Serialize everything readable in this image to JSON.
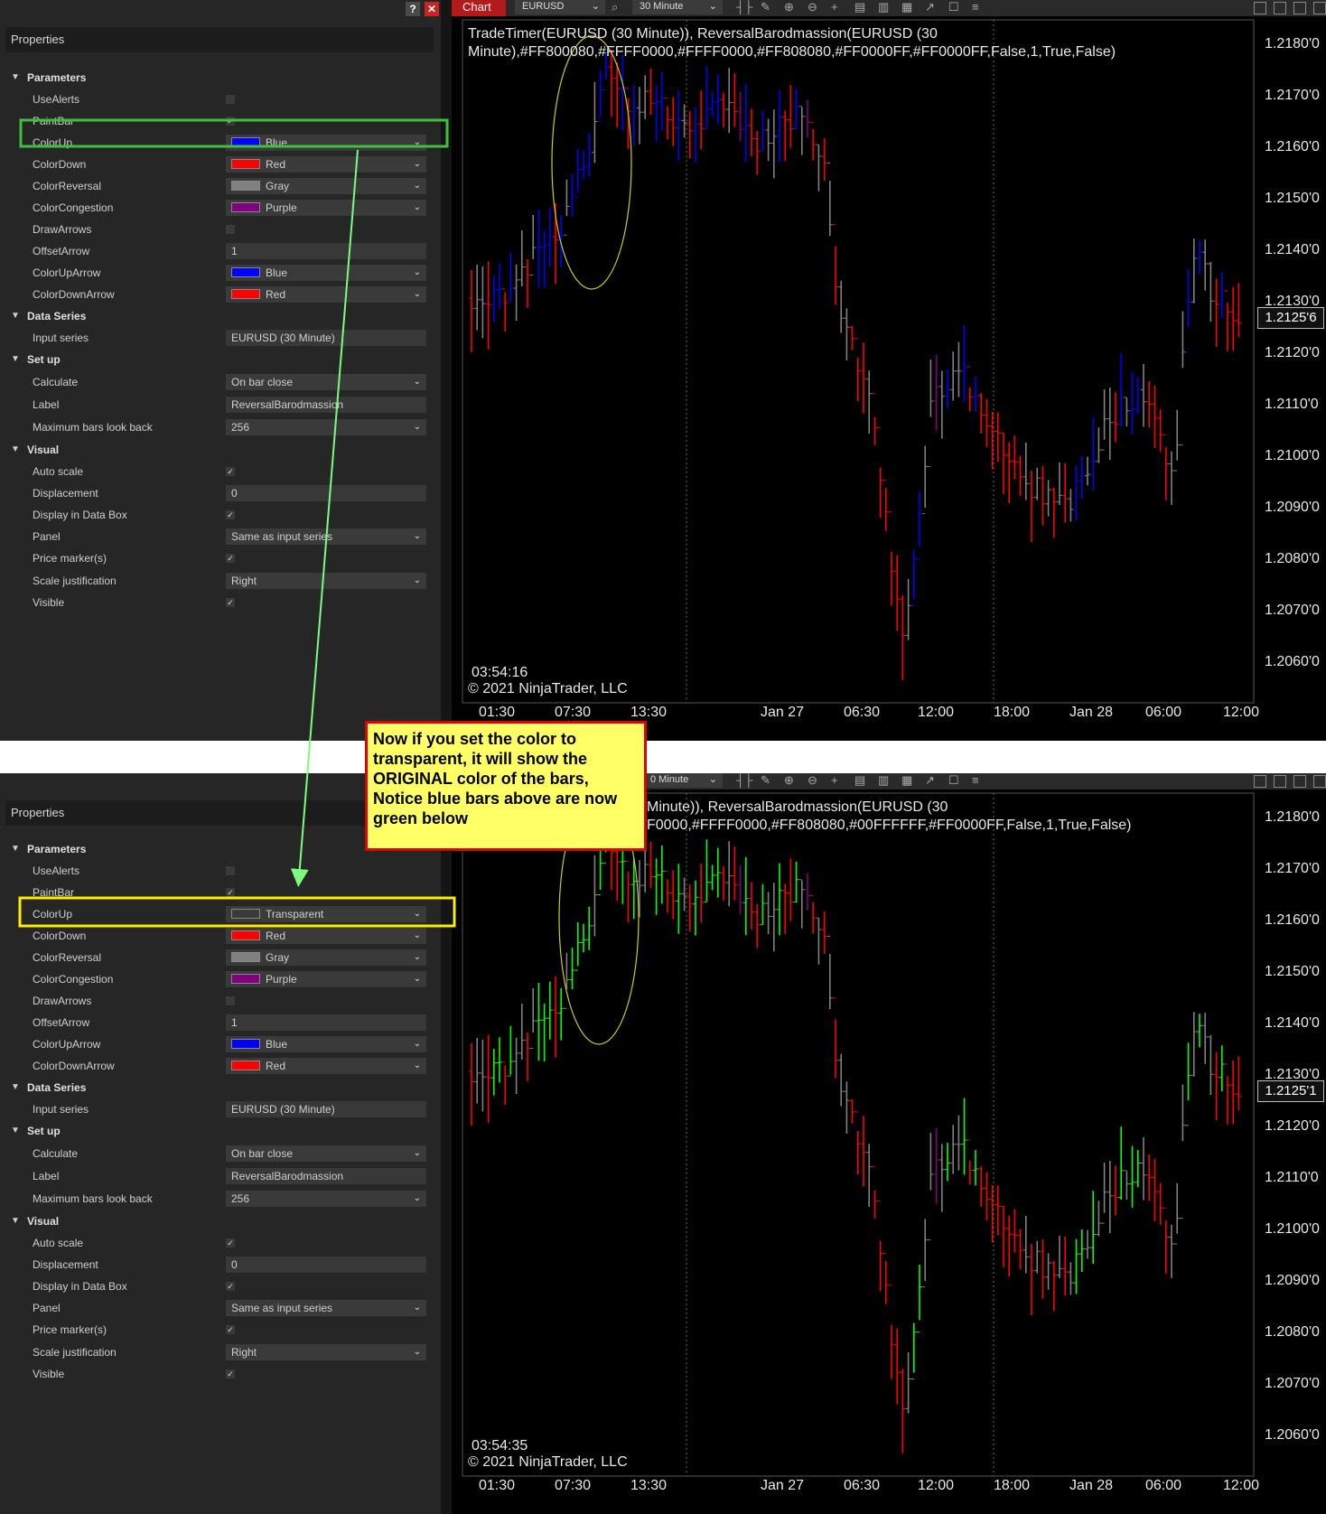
{
  "properties": {
    "title": "Properties",
    "sections": {
      "parameters": "Parameters",
      "data_series": "Data Series",
      "setup": "Set up",
      "visual": "Visual"
    },
    "labels": {
      "use_alerts": "UseAlerts",
      "paint_bar": "PaintBar",
      "color_up": "ColorUp",
      "color_down": "ColorDown",
      "color_reversal": "ColorReversal",
      "color_congestion": "ColorCongestion",
      "draw_arrows": "DrawArrows",
      "offset_arrow": "OffsetArrow",
      "color_up_arrow": "ColorUpArrow",
      "color_down_arrow": "ColorDownArrow",
      "input_series": "Input series",
      "calculate": "Calculate",
      "label": "Label",
      "max_bars": "Maximum bars look back",
      "auto_scale": "Auto scale",
      "displacement": "Displacement",
      "display_in_data_box": "Display in Data Box",
      "panel": "Panel",
      "price_markers": "Price marker(s)",
      "scale_justification": "Scale justification",
      "visible": "Visible"
    },
    "values": {
      "color_down": "Red",
      "color_reversal": "Gray",
      "color_congestion": "Purple",
      "offset_arrow": "1",
      "color_up_arrow": "Blue",
      "color_down_arrow": "Red",
      "input_series": "EURUSD (30 Minute)",
      "calculate": "On bar close",
      "label": "ReversalBarodmassion",
      "max_bars": "256",
      "displacement": "0",
      "panel": "Same as input series",
      "scale_justification": "Right"
    },
    "top_color_up": "Blue",
    "bottom_color_up": "Transparent"
  },
  "colors": {
    "blue": "#0000ff",
    "red": "#ff0000",
    "gray": "#808080",
    "purple": "#800080",
    "green": "#00ff00",
    "highlight_green": "#3fbf3f",
    "highlight_yellow": "#ffee00",
    "callout_bg": "#ffff66",
    "callout_border": "#e00000"
  },
  "chart": {
    "tab": "Chart",
    "instrument": "EURUSD",
    "interval": "30 Minute",
    "interval_partial": "0 Minute",
    "indicator_label_top": "TradeTimer(EURUSD (30 Minute)), ReversalBarodmassion(EURUSD (30 Minute),#FF800080,#FFFF0000,#FFFF0000,#FF808080,#FF0000FF,#FF0000FF,False,1,True,False)",
    "indicator_label_bottom": "Minute)), ReversalBarodmassion(EURUSD (30 F0000,#FFFF0000,#FF808080,#00FFFFFF,#FF0000FF,False,1,True,False)",
    "clock_top": "03:54:16",
    "clock_bottom": "03:54:35",
    "copyright": "© 2021 NinjaTrader, LLC",
    "price_labels": [
      "1.2180'0",
      "1.2170'0",
      "1.2160'0",
      "1.2150'0",
      "1.2140'0",
      "1.2130'0",
      "1.2120'0",
      "1.2110'0",
      "1.2100'0",
      "1.2090'0",
      "1.2080'0",
      "1.2070'0",
      "1.2060'0"
    ],
    "current_price_top": "1.2125'6",
    "current_price_bottom": "1.2125'1",
    "time_labels": [
      "01:30",
      "07:30",
      "13:30",
      "Jan 27",
      "06:30",
      "12:00",
      "18:00",
      "Jan 28",
      "06:00",
      "12:00"
    ]
  },
  "callout": {
    "line1": "Now if you set the color to transparent, it will show the",
    "bold_word": "ORIGINAL",
    "line2": "color of the bars, Notice blue bars above are now green below"
  }
}
